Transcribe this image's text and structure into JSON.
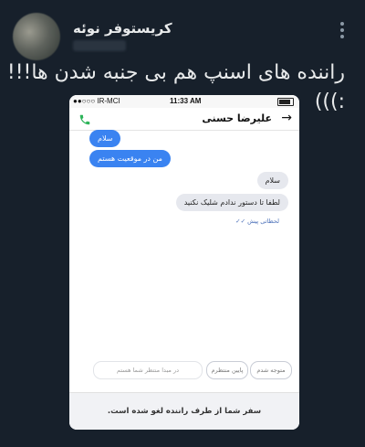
{
  "tweet": {
    "display_name": "کریستوفر نوئه",
    "text": "راننده های اسنپ هم بی جنبه شدن ها!!! :)))"
  },
  "phone": {
    "status_bar": {
      "carrier": "●●○○○ IR-MCI",
      "time": "11:33 AM"
    },
    "header": {
      "contact_name": "علیرضا حسنی"
    },
    "messages": [
      {
        "sender": "driver",
        "text": "سلام"
      },
      {
        "sender": "driver",
        "text": "من در موقعیت هستم"
      },
      {
        "sender": "user",
        "text": "سلام"
      },
      {
        "sender": "user",
        "text": "لطفا تا دستور ندادم شلیک نکنید"
      }
    ],
    "delivery_status": "لحظاتی پیش",
    "quick_replies": [
      "متوجه شدم",
      "پایین منتظرم",
      "در مبدا منتظر شما هستم"
    ],
    "cancel_message": "سفر شما از طرف راننده لغو شده است."
  },
  "colors": {
    "background": "#15202b",
    "driver_bubble": "#3a83f1",
    "user_bubble": "#e6e8ee",
    "call_icon": "#2eb45a"
  }
}
